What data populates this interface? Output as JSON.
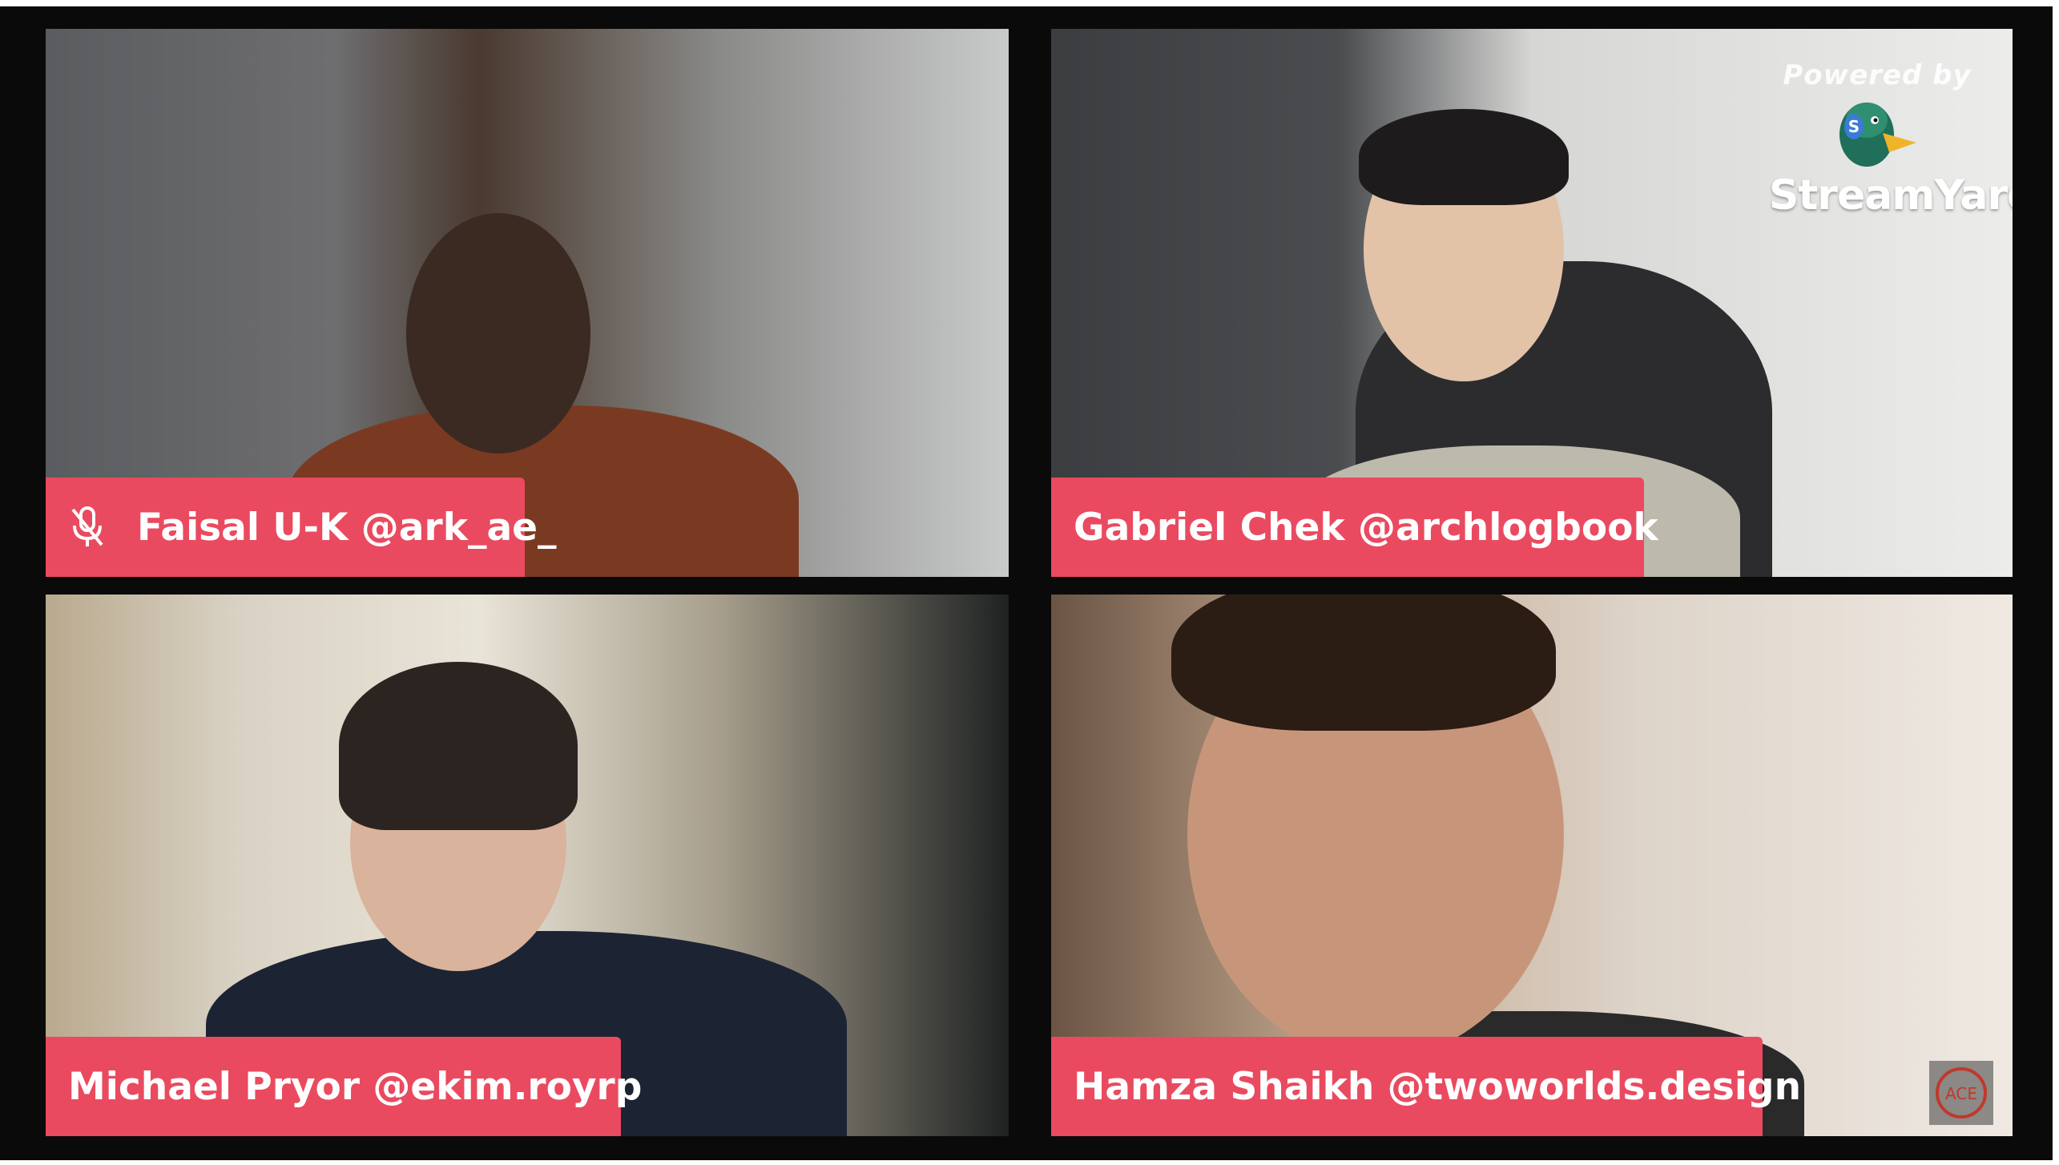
{
  "participants": [
    {
      "label": "Faisal U-K @ark_ae_",
      "muted": true
    },
    {
      "label": "Gabriel Chek @archlogbook",
      "muted": false
    },
    {
      "label": "Michael Pryor @ekim.royrp",
      "muted": false
    },
    {
      "label": "Hamza Shaikh @twoworlds.design",
      "muted": false
    }
  ],
  "branding": {
    "powered_by": "Powered by",
    "name": "StreamYard",
    "corner_badge": "ACE"
  },
  "colors": {
    "label_bg": "#ea4a5f",
    "label_text": "#ffffff",
    "background": "#0a0a0a"
  },
  "icons": {
    "muted": "mic-off-icon",
    "logo": "duck-logo-icon"
  }
}
